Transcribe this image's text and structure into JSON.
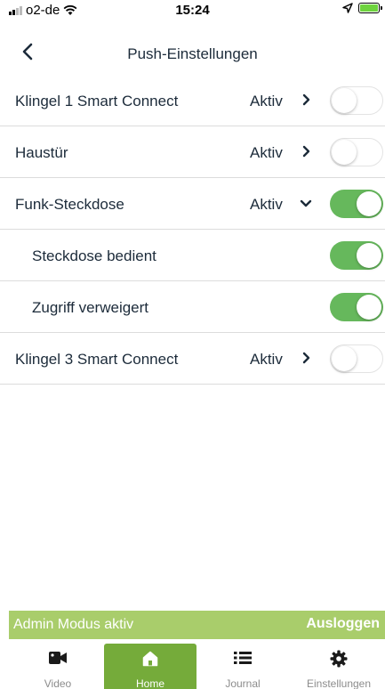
{
  "statusbar": {
    "carrier": "o2-de",
    "time": "15:24"
  },
  "navbar": {
    "title": "Push-Einstellungen"
  },
  "rows": [
    {
      "label": "Klingel 1 Smart Connect",
      "status": "Aktiv",
      "expanded": false,
      "enabled": false
    },
    {
      "label": "Haustür",
      "status": "Aktiv",
      "expanded": false,
      "enabled": false
    },
    {
      "label": "Funk-Steckdose",
      "status": "Aktiv",
      "expanded": true,
      "enabled": true
    },
    {
      "label": "Steckdose bedient",
      "enabled": true
    },
    {
      "label": "Zugriff verweigert",
      "enabled": true
    },
    {
      "label": "Klingel 3 Smart Connect",
      "status": "Aktiv",
      "expanded": false,
      "enabled": false
    }
  ],
  "admin": {
    "text": "Admin Modus aktiv",
    "logout_label": "Ausloggen"
  },
  "tabs": [
    {
      "label": "Video",
      "icon": "video-camera-icon"
    },
    {
      "label": "Home",
      "icon": "home-icon",
      "active": true
    },
    {
      "label": "Journal",
      "icon": "list-icon"
    },
    {
      "label": "Einstellungen",
      "icon": "gear-icon"
    }
  ],
  "colors": {
    "toggle_on": "#66b85c",
    "admin_banner": "#a9cd6b",
    "active_tab": "#75ab3a",
    "text": "#1c2b3a"
  }
}
